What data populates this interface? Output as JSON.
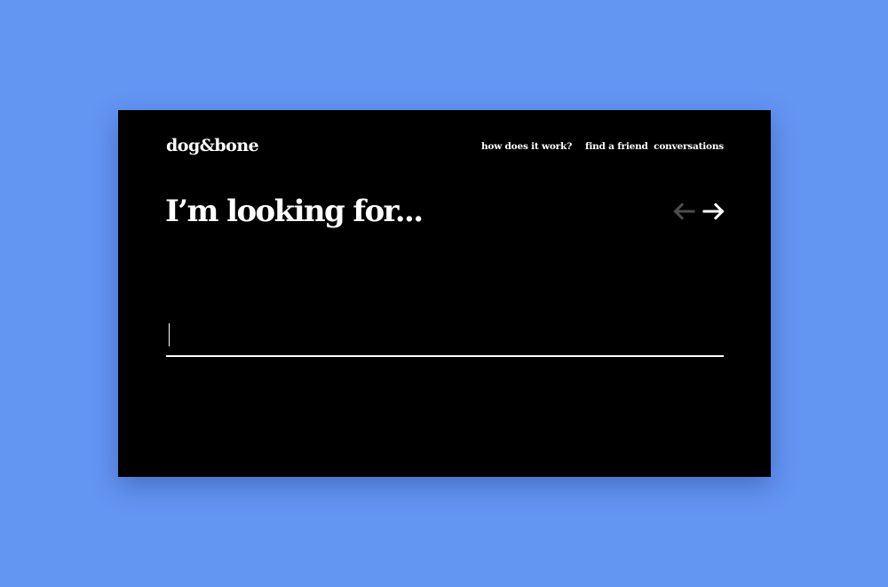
{
  "brand": {
    "logo": "dog&bone"
  },
  "nav": {
    "items": [
      {
        "label": "how does it work?"
      },
      {
        "label": "find a friend"
      },
      {
        "label": "conversations"
      }
    ]
  },
  "main": {
    "headline": "I’m looking for...",
    "search": {
      "value": "",
      "placeholder": ""
    },
    "pager": {
      "prev_icon": "arrow-left-icon",
      "next_icon": "arrow-right-icon"
    }
  },
  "colors": {
    "page_background": "#6395f3",
    "panel_background": "#000000",
    "text": "#ffffff",
    "disabled_arrow": "#4d4d4d"
  }
}
